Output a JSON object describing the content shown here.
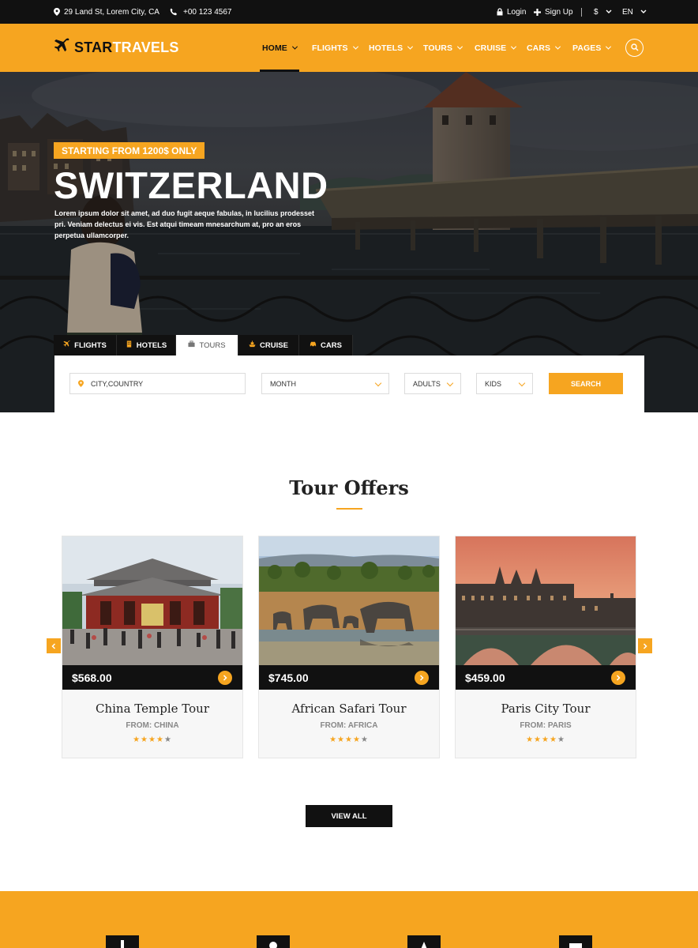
{
  "topbar": {
    "address": "29 Land St, Lorem City, CA",
    "phone": "+00 123 4567",
    "login": "Login",
    "signup": "Sign Up",
    "currency": "$",
    "language": "EN"
  },
  "logo": {
    "part1": "STAR",
    "part2": "TRAVELS"
  },
  "nav": {
    "items": [
      {
        "label": "HOME"
      },
      {
        "label": "FLIGHTS"
      },
      {
        "label": "HOTELS"
      },
      {
        "label": "TOURS"
      },
      {
        "label": "CRUISE"
      },
      {
        "label": "CARS"
      },
      {
        "label": "PAGES"
      }
    ],
    "active": "HOME"
  },
  "hero": {
    "badge": "STARTING FROM 1200$ ONLY",
    "title": "SWITZERLAND",
    "description": "Lorem ipsum dolor sit amet, ad duo fugit aeque fabulas, in lucilius prodesset pri. Veniam delectus ei vis. Est atqui timeam mnesarchum at, pro an eros perpetua ullamcorper."
  },
  "booking": {
    "tabs": [
      {
        "label": "FLIGHTS",
        "icon": "plane-icon"
      },
      {
        "label": "HOTELS",
        "icon": "building-icon"
      },
      {
        "label": "TOURS",
        "icon": "briefcase-icon"
      },
      {
        "label": "CRUISE",
        "icon": "ship-icon"
      },
      {
        "label": "CARS",
        "icon": "car-icon"
      }
    ],
    "active_tab": "TOURS",
    "destination_placeholder": "CITY,COUNTRY",
    "month_label": "MONTH",
    "adults_label": "ADULTS",
    "kids_label": "KIDS",
    "search_label": "SEARCH"
  },
  "offers": {
    "title": "Tour Offers",
    "cards": [
      {
        "price": "$568.00",
        "name": "China Temple Tour",
        "from": "FROM: CHINA",
        "rating": 4,
        "max_rating": 5
      },
      {
        "price": "$745.00",
        "name": "African Safari Tour",
        "from": "FROM: AFRICA",
        "rating": 4,
        "max_rating": 5
      },
      {
        "price": "$459.00",
        "name": "Paris City Tour",
        "from": "FROM: PARIS",
        "rating": 4,
        "max_rating": 5
      }
    ],
    "view_all": "VIEW ALL"
  },
  "colors": {
    "accent": "#f6a520",
    "dark": "#111111"
  }
}
